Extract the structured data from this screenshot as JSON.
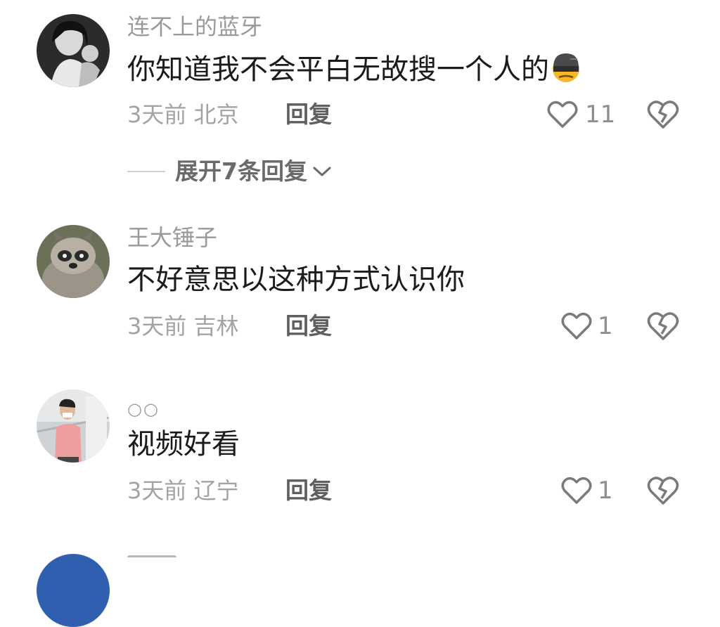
{
  "comments": [
    {
      "username": "连不上的蓝牙",
      "text": "你知道我不会平白无故搜一个人的",
      "emoji": "helmet-emoji",
      "time": "3天前",
      "location": "北京",
      "reply_label": "回复",
      "likes": "11",
      "expand_label": "展开7条回复"
    },
    {
      "username": "王大锤子",
      "text": "不好意思以这种方式认识你",
      "time": "3天前",
      "location": "吉林",
      "reply_label": "回复",
      "likes": "1"
    },
    {
      "username": "○○",
      "text": "视频好看",
      "time": "3天前",
      "location": "辽宁",
      "reply_label": "回复",
      "likes": "1"
    }
  ],
  "icons": {
    "like": "heart-outline-icon",
    "dislike": "broken-heart-icon",
    "expand": "chevron-down-icon"
  },
  "colors": {
    "username": "#9a9a9a",
    "text": "#1b1b1b",
    "meta": "#a3a3a3",
    "reply": "#5f5f5f"
  }
}
